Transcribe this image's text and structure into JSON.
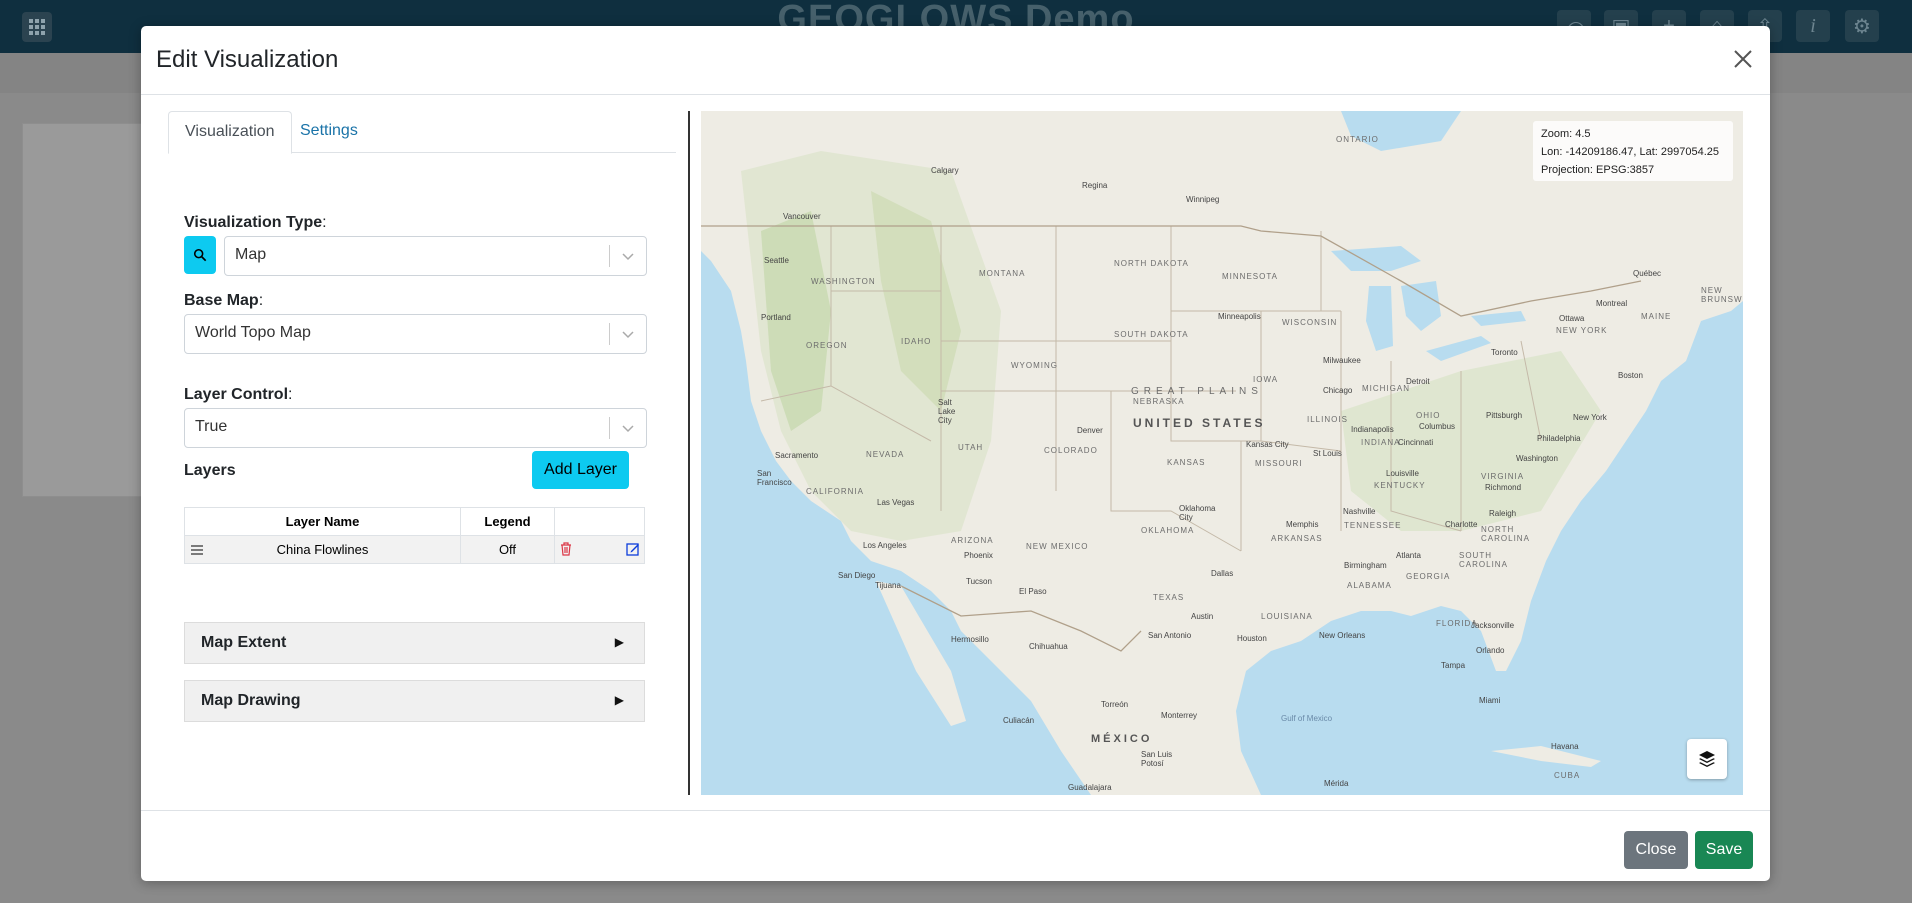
{
  "app": {
    "title": "GEOGLOWS Demo",
    "toolbar_icons": [
      "undo-icon",
      "save-icon",
      "plus-icon",
      "lock-icon",
      "upload-icon",
      "info-icon",
      "gear-icon"
    ]
  },
  "modal": {
    "title": "Edit Visualization",
    "tabs": [
      {
        "label": "Visualization",
        "active": true
      },
      {
        "label": "Settings",
        "active": false
      }
    ],
    "visualization_type": {
      "label": "Visualization Type",
      "suffix": ":",
      "value": "Map"
    },
    "base_map": {
      "label": "Base Map",
      "suffix": ":",
      "value": "World Topo Map"
    },
    "layer_control": {
      "label": "Layer Control",
      "suffix": ":",
      "value": "True"
    },
    "layers": {
      "title": "Layers",
      "add_button": "Add Layer",
      "columns": [
        "Layer Name",
        "Legend",
        ""
      ],
      "rows": [
        {
          "name": "China Flowlines",
          "legend": "Off"
        }
      ]
    },
    "accordions": [
      {
        "label": "Map Extent",
        "arrow": "▶"
      },
      {
        "label": "Map Drawing",
        "arrow": "▶"
      }
    ],
    "map": {
      "zoom_text": "Zoom: 4.5",
      "lonlat_text": "Lon: -14209186.47, Lat: 2997054.25",
      "projection_text": "Projection: EPSG:3857",
      "labels": {
        "us": "UNITED STATES",
        "great_plains": "GREAT PLAINS",
        "mexico": "MÉXICO",
        "north_dakota": "NORTH DAKOTA",
        "south_dakota": "SOUTH DAKOTA",
        "montana": "MONTANA",
        "wyoming": "WYOMING",
        "colorado": "COLORADO",
        "nebraska": "NEBRASKA",
        "kansas": "KANSAS",
        "texas": "TEXAS",
        "oklahoma": "OKLAHOMA",
        "new_mexico": "NEW MEXICO",
        "arizona": "ARIZONA",
        "utah": "UTAH",
        "nevada": "NEVADA",
        "california": "CALIFORNIA",
        "oregon": "OREGON",
        "washington": "WASHINGTON",
        "idaho": "IDAHO",
        "minnesota": "MINNESOTA",
        "iowa": "IOWA",
        "missouri": "MISSOURI",
        "wisconsin": "WISCONSIN",
        "illinois": "ILLINOIS",
        "michigan": "MICHIGAN",
        "ohio": "OHIO",
        "indiana": "INDIANA",
        "kentucky": "KENTUCKY",
        "tennessee": "TENNESSEE",
        "arkansas": "ARKANSAS",
        "louisiana": "LOUISIANA",
        "alabama": "ALABAMA",
        "georgia": "GEORGIA",
        "florida": "FLORIDA",
        "virginia": "VIRGINIA",
        "north_carolina": "NORTH CAROLINA",
        "south_carolina": "SOUTH CAROLINA",
        "new_york": "NEW YORK",
        "maine": "MAINE",
        "ontario": "ONTARIO",
        "new_brunswick": "NEW BRUNSWICK",
        "gulf": "Gulf of Mexico",
        "cuba": "CUBA",
        "cities": {
          "seattle": "Seattle",
          "portland": "Portland",
          "sacramento": "Sacramento",
          "san_francisco": "San Francisco",
          "los_angeles": "Los Angeles",
          "san_diego": "San Diego",
          "las_vegas": "Las Vegas",
          "phoenix": "Phoenix",
          "tucson": "Tucson",
          "salt_lake": "Salt Lake City",
          "denver": "Denver",
          "el_paso": "El Paso",
          "dallas": "Dallas",
          "austin": "Austin",
          "houston": "Houston",
          "san_antonio": "San Antonio",
          "oklahoma_city": "Oklahoma City",
          "kansas_city": "Kansas City",
          "st_louis": "St Louis",
          "minneapolis": "Minneapolis",
          "chicago": "Chicago",
          "milwaukee": "Milwaukee",
          "detroit": "Detroit",
          "indianapolis": "Indianapolis",
          "columbus": "Columbus",
          "cincinnati": "Cincinnati",
          "louisville": "Louisville",
          "nashville": "Nashville",
          "memphis": "Memphis",
          "atlanta": "Atlanta",
          "birmingham": "Birmingham",
          "new_orleans": "New Orleans",
          "jacksonville": "Jacksonville",
          "orlando": "Orlando",
          "tampa": "Tampa",
          "miami": "Miami",
          "charlotte": "Charlotte",
          "raleigh": "Raleigh",
          "richmond": "Richmond",
          "washington_dc": "Washington",
          "philadelphia": "Philadelphia",
          "new_york": "New York",
          "boston": "Boston",
          "pittsburgh": "Pittsburgh",
          "toronto": "Toronto",
          "ottawa": "Ottawa",
          "montreal": "Montreal",
          "quebec": "Québec",
          "winnipeg": "Winnipeg",
          "regina": "Regina",
          "calgary": "Calgary",
          "vancouver": "Vancouver",
          "monterrey": "Monterrey",
          "hermosillo": "Hermosillo",
          "chihuahua": "Chihuahua",
          "culiacan": "Culiacán",
          "torreon": "Torreón",
          "san_luis_potosi": "San Luis Potosí",
          "merida": "Mérida",
          "havana": "Havana",
          "guadalajara": "Guadalajara",
          "tijuana": "Tijuana"
        }
      }
    },
    "footer": {
      "close": "Close",
      "save": "Save"
    }
  }
}
